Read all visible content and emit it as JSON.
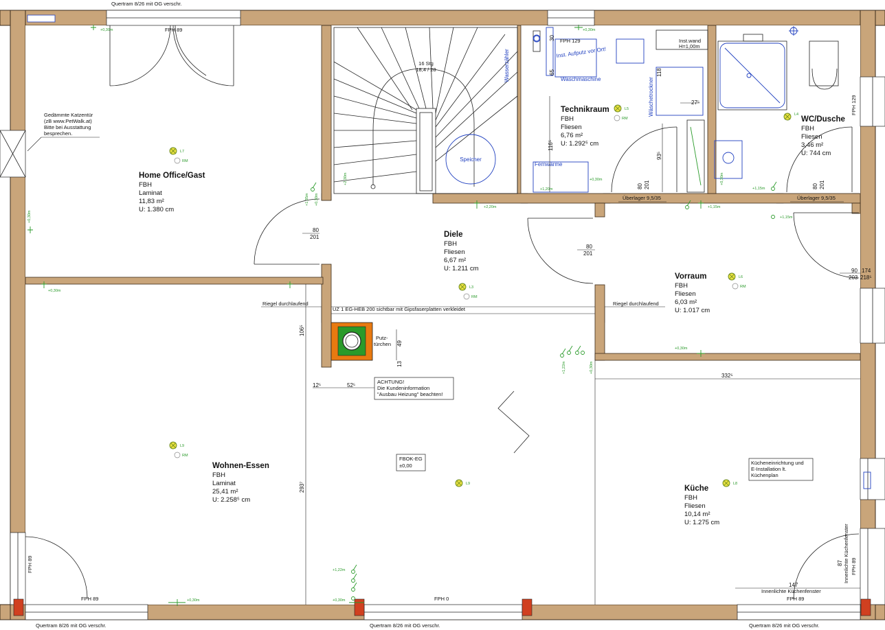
{
  "rooms": {
    "home_office": {
      "name": "Home Office/Gast",
      "floor": "FBH",
      "material": "Laminat",
      "area": "11,83 m²",
      "perimeter": "U: 1.380 cm"
    },
    "technikraum": {
      "name": "Technikraum",
      "floor": "FBH",
      "material": "Fliesen",
      "area": "6,76 m²",
      "perimeter": "U: 1.292⁵ cm"
    },
    "wc_dusche": {
      "name": "WC/Dusche",
      "floor": "FBH",
      "material": "Fliesen",
      "area": "3,46 m²",
      "perimeter": "U: 744 cm"
    },
    "diele": {
      "name": "Diele",
      "floor": "FBH",
      "material": "Fliesen",
      "area": "6,67 m²",
      "perimeter": "U: 1.211 cm"
    },
    "vorraum": {
      "name": "Vorraum",
      "floor": "FBH",
      "material": "Fliesen",
      "area": "6,03 m²",
      "perimeter": "U: 1.017 cm"
    },
    "wohnen_essen": {
      "name": "Wohnen-Essen",
      "floor": "FBH",
      "material": "Laminat",
      "area": "25,41 m²",
      "perimeter": "U: 2.258⁵ cm"
    },
    "kueche": {
      "name": "Küche",
      "floor": "FBH",
      "material": "Fliesen",
      "area": "10,14 m²",
      "perimeter": "U: 1.275 cm"
    }
  },
  "notes": {
    "katzentuer": [
      "Gedämmte Katzentür",
      "(zB www.PetWalk.at)",
      "Bitte bei Ausstattung",
      "besprechen."
    ],
    "achtung": [
      "ACHTUNG!",
      "Die Kundeninformation",
      "\"Ausbau Heizung\" beachten!"
    ],
    "fbok": [
      "FBOK-EG",
      "±0,00"
    ],
    "kuechen": [
      "Kücheneinrichtung und",
      "E-Installation lt.",
      "Küchenplan"
    ],
    "uz": "UZ 1 EG-HEB 200 sichtbar mit Gipsfaserplatten verkleidet",
    "riegel_left": "Riegel durchlaufend",
    "riegel_right": "Riegel durchlaufend",
    "putz1": "Putz-",
    "putz2": "türchen",
    "installwand1": "Inst.wand",
    "installwand2": "H=1,00m",
    "inst_aufputz": "Inst. Aufputz vor Ort!",
    "innen_kuechenfenster": "Innenlichte Küchenfenster",
    "innen_kuechenfenster_v": "Innenlichte Küchenfenster"
  },
  "labels": {
    "quertram_top": "Quertram 8/26 mit OG verschr.",
    "quertram_b1": "Quertram 8/26 mit OG verschr.",
    "quertram_b2": "Quertram 8/26 mit OG verschr.",
    "quertram_b3": "Quertram 8/26 mit OG verschr.",
    "fph89_top": "FPH 89",
    "fph129_top": "FPH 129",
    "fph129_right": "FPH 129",
    "fph89_left": "FPH 89",
    "fph89_bl": "FPH 89",
    "fph0": "FPH 0",
    "fph89_br": "FPH 89",
    "fph89_rv": "FPH 89",
    "stairs1": "16 Stg",
    "stairs2": "18,4 / 28",
    "speicher": "Speicher",
    "wasserzaehler": "Wasserzähler",
    "waschmaschine": "Waschmaschine",
    "waeschetrockner": "Wäschetrockner",
    "fernwaerme": "Fernwärme",
    "ueberlager1": "Überlager 9,5/35",
    "ueberlager2": "Überlager 9,5/35",
    "rm": "RM"
  },
  "dims": {
    "d80a": "80",
    "d201a": "201",
    "d80b": "80",
    "d201b": "201",
    "d90": "90",
    "d203": "203",
    "d174": "174",
    "d218": "218⁵",
    "d106": "106⁵",
    "d49": "49",
    "d13": "13",
    "d125": "12⁵",
    "d525": "52⁵",
    "d293": "293⁷",
    "d3325": "332⁵",
    "d147": "147",
    "d87": "87",
    "d30": "30",
    "d65": "65",
    "d118": "118",
    "d116": "116⁵",
    "d935": "93⁵",
    "d80c": "80",
    "d201c": "201",
    "d80d": "80",
    "d201d": "201",
    "d275": "27⁵"
  },
  "lamps": {
    "l7": "L7",
    "l5a": "L5",
    "l3": "L3",
    "l4": "L4",
    "l6": "L6",
    "l9": "L9",
    "l8": "L8"
  },
  "heights": {
    "h030": "+0,30m",
    "h122": "+1,22m",
    "h120": "+1,20m",
    "h115": "+1,15m",
    "h220": "+2,20m",
    "h135": "+1,35m",
    "h230": "+2,30m"
  }
}
